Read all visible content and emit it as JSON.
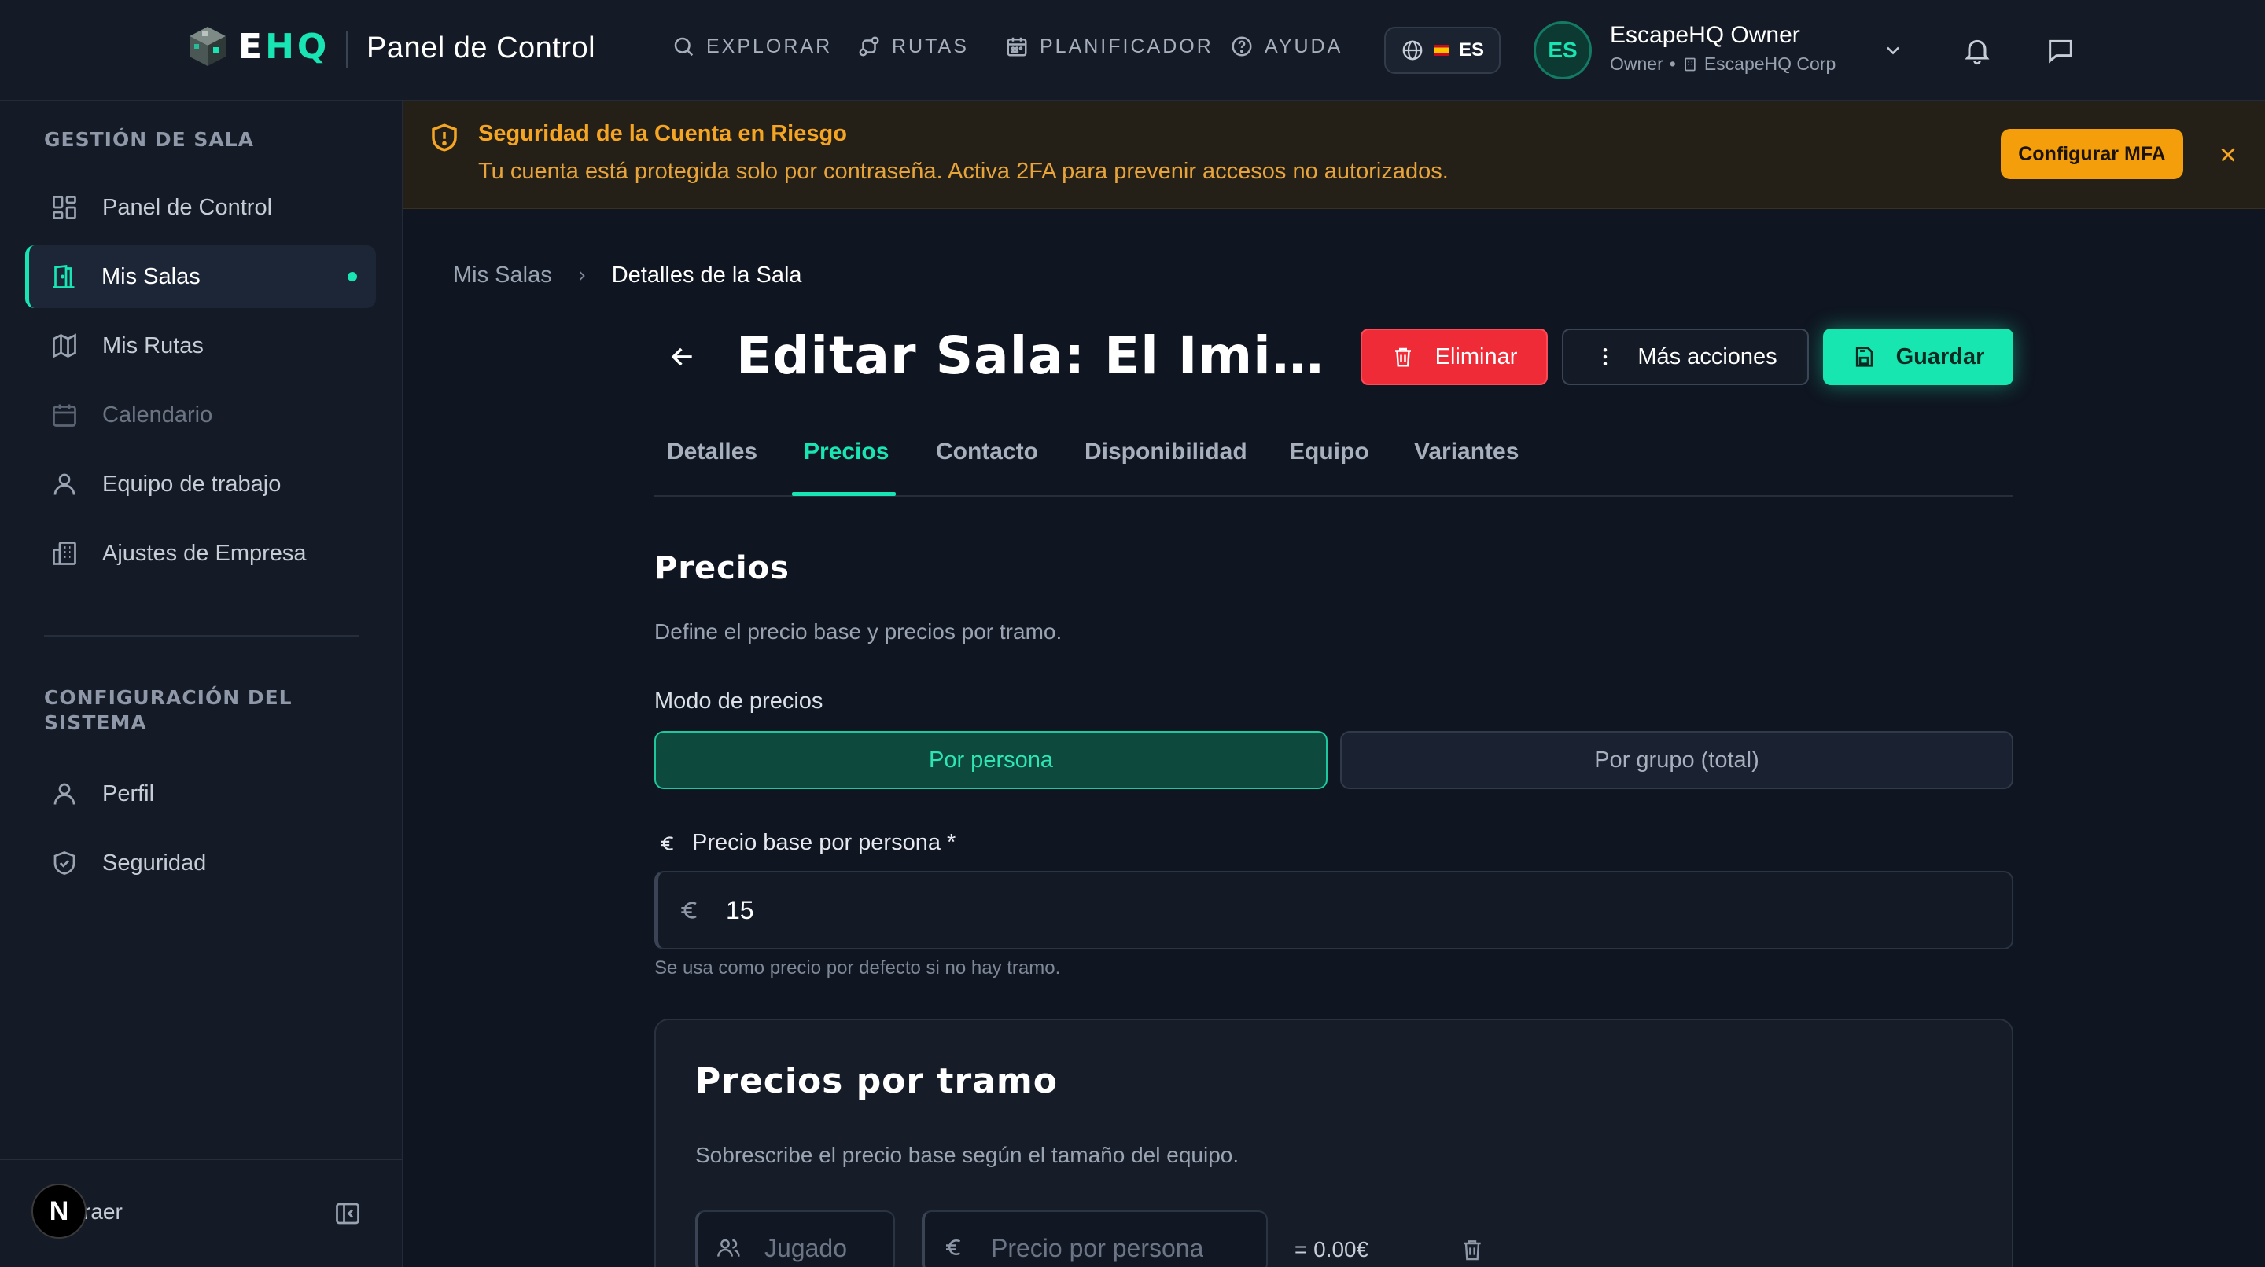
{
  "brand": {
    "logo_e": "E",
    "logo_hq": "HQ",
    "app_title": "Panel de Control"
  },
  "nav": [
    {
      "label": "EXPLORAR",
      "icon": "search-icon"
    },
    {
      "label": "RUTAS",
      "icon": "route-icon"
    },
    {
      "label": "PLANIFICADOR",
      "icon": "calendar-icon"
    },
    {
      "label": "AYUDA",
      "icon": "help-icon"
    }
  ],
  "language": {
    "code": "ES"
  },
  "user": {
    "initials": "ES",
    "name": "EscapeHQ Owner",
    "role": "Owner",
    "company": "EscapeHQ Corp"
  },
  "sidebar": {
    "section1": "GESTIÓN DE SALA",
    "items1": [
      {
        "label": "Panel de Control"
      },
      {
        "label": "Mis Salas"
      },
      {
        "label": "Mis Rutas"
      },
      {
        "label": "Calendario"
      },
      {
        "label": "Equipo de trabajo"
      },
      {
        "label": "Ajustes de Empresa"
      }
    ],
    "section2": "CONFIGURACIÓN DEL SISTEMA",
    "items2": [
      {
        "label": "Perfil"
      },
      {
        "label": "Seguridad"
      }
    ],
    "collapse_label": "raer",
    "badge": "N"
  },
  "alert": {
    "title": "Seguridad de la Cuenta en Riesgo",
    "message": "Tu cuenta está protegida solo por contraseña. Activa 2FA para prevenir accesos no autorizados.",
    "action": "Configurar MFA"
  },
  "breadcrumb": {
    "parent": "Mis Salas",
    "current": "Detalles de la Sala"
  },
  "page": {
    "title": "Editar Sala: El Imitador"
  },
  "actions": {
    "delete": "Eliminar",
    "more": "Más acciones",
    "save": "Guardar"
  },
  "tabs": [
    "Detalles",
    "Precios",
    "Contacto",
    "Disponibilidad",
    "Equipo",
    "Variantes"
  ],
  "pricing": {
    "title": "Precios",
    "description": "Define el precio base y precios por tramo.",
    "mode_label": "Modo de precios",
    "mode_per_person": "Por persona",
    "mode_group": "Por grupo (total)",
    "base_label": "Precio base por persona *",
    "base_value": "15",
    "base_hint": "Se usa como precio por defecto si no hay tramo."
  },
  "tiers": {
    "title": "Precios por tramo",
    "description": "Sobrescribe el precio base según el tamaño del equipo.",
    "players_placeholder": "Jugadores",
    "price_placeholder": "Precio por persona",
    "total": "= 0.00€"
  },
  "colors": {
    "accent": "#19e5b4",
    "danger": "#ef2b38",
    "warning": "#f59e0b",
    "background": "#0f1521"
  }
}
